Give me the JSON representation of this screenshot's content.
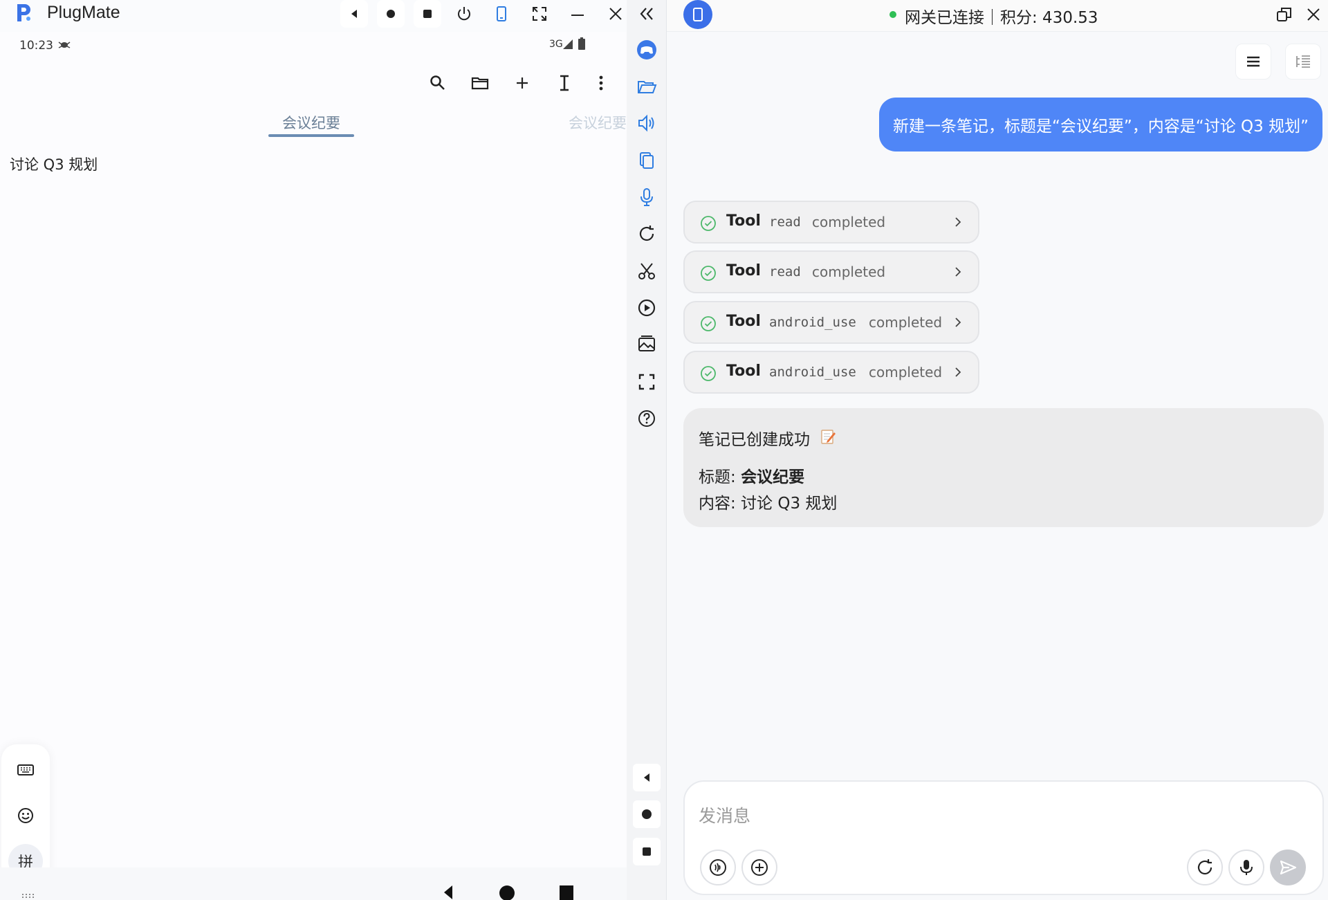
{
  "app": {
    "title": "PlugMate"
  },
  "phone": {
    "status_time": "10:23",
    "status_network": "3G",
    "tabs": [
      "会议纪要",
      "会议纪要"
    ],
    "note_content": "讨论 Q3 规划",
    "ime_pinyin_label": "拼"
  },
  "chat": {
    "gateway_status": "网关已连接｜积分: 430.53",
    "user_message": "新建一条笔记，标题是“会议纪要”，内容是“讨论 Q3 规划”",
    "tool_calls": [
      {
        "label": "Tool",
        "name": "read",
        "status": "completed"
      },
      {
        "label": "Tool",
        "name": "read",
        "status": "completed"
      },
      {
        "label": "Tool",
        "name": "android_use",
        "status": "completed"
      },
      {
        "label": "Tool",
        "name": "android_use",
        "status": "completed"
      }
    ],
    "assistant": {
      "headline": "笔记已创建成功",
      "title_label": "标题: ",
      "title_value": "会议纪要",
      "content_line": "内容: 讨论 Q3 规划"
    },
    "composer_placeholder": "发消息"
  },
  "colors": {
    "accent_blue": "#4f86f7",
    "status_green": "#2fbf55",
    "tab_underline": "#6b8cb3"
  }
}
